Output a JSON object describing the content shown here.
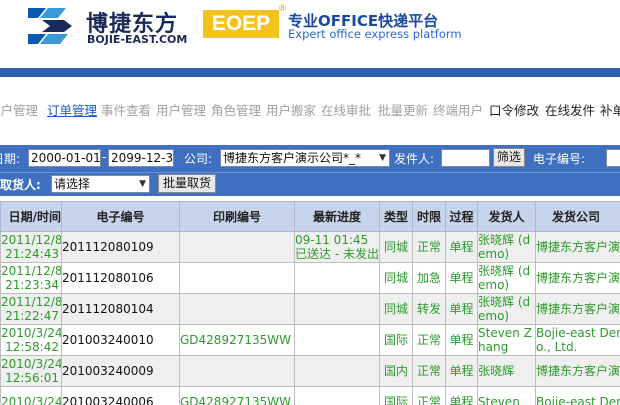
{
  "header": {
    "logo_cn": "博捷东方",
    "logo_en": "BOJIE-EAST.COM",
    "badge": "EOEP",
    "badge_reg": "®",
    "slogan_cn": "专业OFFICE快递平台",
    "slogan_en": "Expert office express platform"
  },
  "nav": {
    "items": [
      {
        "label": "客户管理"
      },
      {
        "label": "订单管理"
      },
      {
        "label": "事件查看"
      },
      {
        "label": "用户管理"
      },
      {
        "label": "角色管理"
      },
      {
        "label": "用户搬家"
      },
      {
        "label": "在线审批"
      },
      {
        "label": "批量更新"
      },
      {
        "label": "终端用户"
      },
      {
        "label": "口令修改"
      },
      {
        "label": "在线发件"
      },
      {
        "label": "补单"
      }
    ]
  },
  "filters": {
    "date_label": "日期:",
    "date_from": "2000-01-01",
    "date_sep": "-",
    "date_to": "2099-12-31",
    "company_label": "公司:",
    "company_value": "博捷东方客户演示公司*_*",
    "sender_label": "发件人:",
    "sender_value": "",
    "filter_button": "筛选",
    "number_label": "电子编号:",
    "pickup_label": "取货人:",
    "pickup_value": "请选择",
    "batch_button": "批量取货"
  },
  "table": {
    "headers": [
      "日期/时间",
      "电子编号",
      "印刷编号",
      "最新进度",
      "类型",
      "时限",
      "过程",
      "发货人",
      "发货公司"
    ],
    "rows": [
      {
        "date": "2011/12/8",
        "time": "21:24:43",
        "eno": "201112080109",
        "pno": "",
        "prog1": "09-11 01:45",
        "prog2": "已送达 - 未发出",
        "type": "同城",
        "limit": "正常",
        "proc": "单程",
        "sender": "张晓辉 (demo)",
        "company": "博捷东方客户演"
      },
      {
        "date": "2011/12/8",
        "time": "21:23:34",
        "eno": "201112080106",
        "pno": "",
        "prog1": "",
        "prog2": "",
        "type": "同城",
        "limit": "加急",
        "proc": "单程",
        "sender": "张晓辉 (demo)",
        "company": "博捷东方客户演"
      },
      {
        "date": "2011/12/8",
        "time": "21:22:47",
        "eno": "201112080104",
        "pno": "",
        "prog1": "",
        "prog2": "",
        "type": "同城",
        "limit": "转发",
        "proc": "单程",
        "sender": "张晓辉 (demo)",
        "company": "博捷东方客户演"
      },
      {
        "date": "2010/3/24",
        "time": "12:58:42",
        "eno": "201003240010",
        "pno": "GD428927135WW",
        "prog1": "",
        "prog2": "",
        "type": "国际",
        "limit": "正常",
        "proc": "单程",
        "sender": "Steven Zhang",
        "company": "Bojie-east Der Co., Ltd."
      },
      {
        "date": "2010/3/24",
        "time": "12:56:01",
        "eno": "201003240009",
        "pno": "",
        "prog1": "",
        "prog2": "",
        "type": "国内",
        "limit": "正常",
        "proc": "单程",
        "sender": "张晓辉",
        "company": "博捷东方客户演"
      },
      {
        "date": "2010/3/24",
        "time": "",
        "eno": "201003240006",
        "pno": "GD428927135WW",
        "prog1": "",
        "prog2": "",
        "type": "国际",
        "limit": "正常",
        "proc": "单程",
        "sender": "Steven",
        "company": "Bojie-east Der"
      }
    ]
  }
}
